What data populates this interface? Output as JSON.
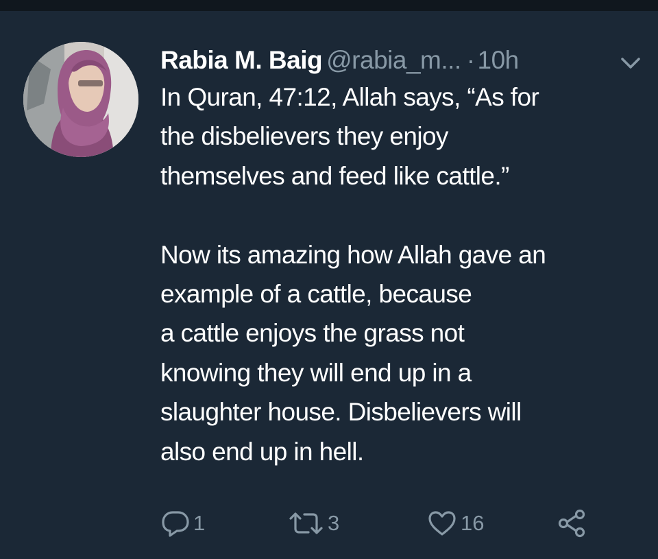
{
  "tweet": {
    "author_name": "Rabia M. Baig",
    "handle": "@rabia_m...",
    "separator": "·",
    "time": "10h",
    "text_lines": [
      "In Quran, 47:12, Allah says, “As for",
      "the disbelievers they enjoy",
      "themselves and feed like cattle.”",
      "",
      "Now its amazing how Allah gave an",
      "example of a cattle, because",
      "a cattle enjoys the grass not",
      "knowing they will end up in a",
      "slaughter house. Disbelievers will",
      "also end up in hell."
    ],
    "actions": {
      "reply_count": "1",
      "retweet_count": "3",
      "like_count": "16"
    }
  },
  "icons": {
    "caret": "chevron-down-icon",
    "reply": "reply-icon",
    "retweet": "retweet-icon",
    "like": "heart-icon",
    "share": "share-icon"
  },
  "colors": {
    "background": "#1b2836",
    "top_bar": "#10171e",
    "text": "#ffffff",
    "secondary_text": "#8899a6"
  }
}
